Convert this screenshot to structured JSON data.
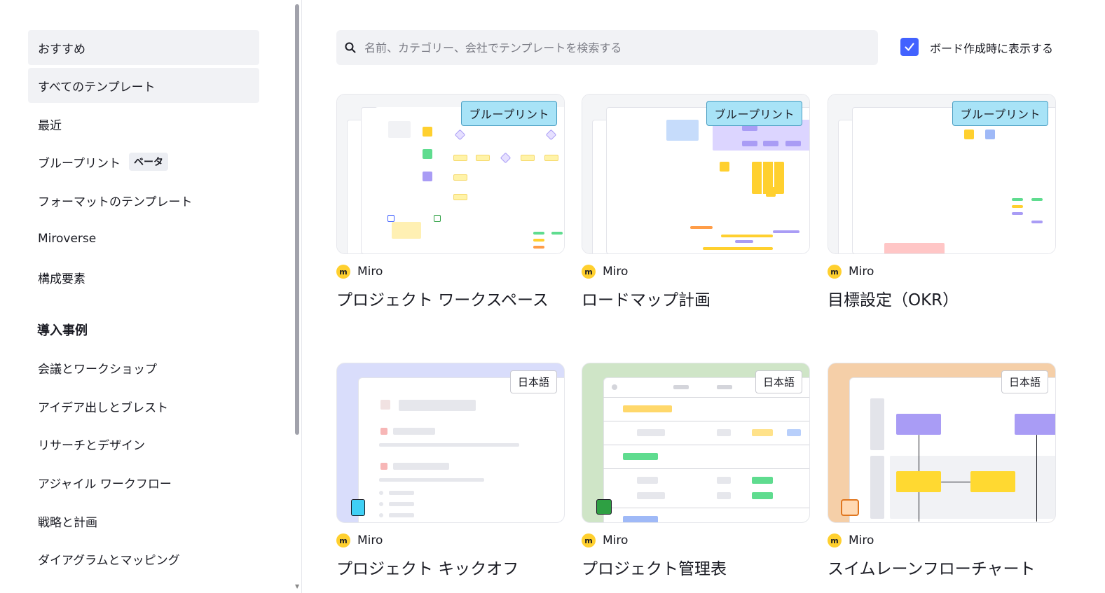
{
  "sidebar": {
    "items": [
      {
        "label": "おすすめ"
      },
      {
        "label": "すべてのテンプレート"
      },
      {
        "label": "最近"
      },
      {
        "label": "ブループリント",
        "badge": "ベータ"
      },
      {
        "label": "フォーマットのテンプレート"
      },
      {
        "label": "Miroverse"
      },
      {
        "label": "構成要素"
      }
    ],
    "section_heading": "導入事例",
    "usecases": [
      {
        "label": "会議とワークショップ"
      },
      {
        "label": "アイデア出しとブレスト"
      },
      {
        "label": "リサーチとデザイン"
      },
      {
        "label": "アジャイル ワークフロー"
      },
      {
        "label": "戦略と計画"
      },
      {
        "label": "ダイアグラムとマッピング"
      }
    ]
  },
  "search": {
    "placeholder": "名前、カテゴリー、会社でテンプレートを検索する",
    "icon": "search-icon"
  },
  "show_on_create": {
    "label": "ボード作成時に表示する",
    "checked": true,
    "color": "#4262ff"
  },
  "cards": [
    {
      "title": "プロジェクト ワークスペース",
      "owner": "Miro",
      "tag": "ブループリント"
    },
    {
      "title": "ロードマップ計画",
      "owner": "Miro",
      "tag": "ブループリント"
    },
    {
      "title": "目標設定（OKR）",
      "owner": "Miro",
      "tag": "ブループリント"
    },
    {
      "title": "プロジェクト キックオフ",
      "owner": "Miro",
      "tag": "日本語"
    },
    {
      "title": "プロジェクト管理表",
      "owner": "Miro",
      "tag": "日本語"
    },
    {
      "title": "スイムレーンフローチャート",
      "owner": "Miro",
      "tag": "日本語"
    }
  ],
  "colors": {
    "brand_yellow": "#ffd02f",
    "blueprint_tag": "#a8e3f7",
    "kickoff_bg": "#d9ddfb",
    "table_bg": "#cfe5c7",
    "swimlane_bg": "#f5cfa8"
  }
}
